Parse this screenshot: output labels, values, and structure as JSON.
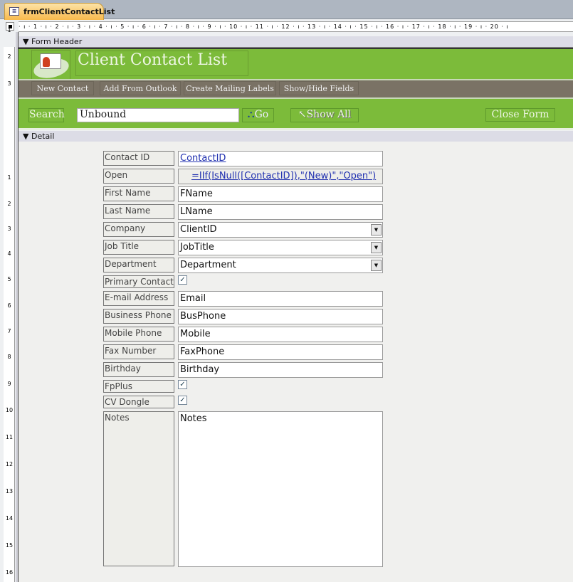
{
  "tab": {
    "title": "frmClientContactList"
  },
  "ruler": {
    "h": "· ı · 1 · ı · 2 · ı · 3 · ı · 4 · ı · 5 · ı · 6 · ı · 7 · ı · 8 · ı · 9 · ı · 10 · ı · 11 · ı · 12 · ı · 13 · ı · 14 · ı · 15 · ı · 16 · ı · 17 · ı · 18 · ı · 19 · ı · 20 · ı",
    "v": [
      "1",
      "2",
      "3",
      "1",
      "2",
      "3",
      "4",
      "5",
      "6",
      "7",
      "8",
      "9",
      "10",
      "11",
      "12",
      "13",
      "14",
      "15",
      "16"
    ]
  },
  "sections": {
    "header": "Form Header",
    "detail": "Detail"
  },
  "header": {
    "title": "Client Contact List",
    "menu": [
      "New Contact",
      "Add From Outlook",
      "Create Mailing Labels",
      "Show/Hide Fields"
    ],
    "search_label": "Search",
    "search_value": "Unbound",
    "go": "Go",
    "show_all": "Show All",
    "close": "Close Form"
  },
  "fields": [
    {
      "label": "Contact ID",
      "value": "ContactID",
      "type": "link"
    },
    {
      "label": "Open",
      "value": "=IIf(IsNull([ContactID]),\"(New)\",\"Open\")",
      "type": "link"
    },
    {
      "label": "First Name",
      "value": "FName",
      "type": "text"
    },
    {
      "label": "Last Name",
      "value": "LName",
      "type": "text"
    },
    {
      "label": "Company",
      "value": "ClientID",
      "type": "combo"
    },
    {
      "label": "Job Title",
      "value": "JobTitle",
      "type": "combo"
    },
    {
      "label": "Department",
      "value": "Department",
      "type": "combo"
    },
    {
      "label": "Primary Contact",
      "type": "check"
    },
    {
      "label": "E-mail Address",
      "value": "Email",
      "type": "text"
    },
    {
      "label": "Business Phone",
      "value": "BusPhone",
      "type": "text"
    },
    {
      "label": "Mobile Phone",
      "value": "Mobile",
      "type": "text"
    },
    {
      "label": "Fax Number",
      "value": "FaxPhone",
      "type": "text"
    },
    {
      "label": "Birthday",
      "value": "Birthday",
      "type": "text"
    },
    {
      "label": "FpPlus",
      "type": "check"
    },
    {
      "label": "CV Dongle",
      "type": "check"
    },
    {
      "label": "Notes",
      "value": "Notes",
      "type": "memo"
    }
  ]
}
